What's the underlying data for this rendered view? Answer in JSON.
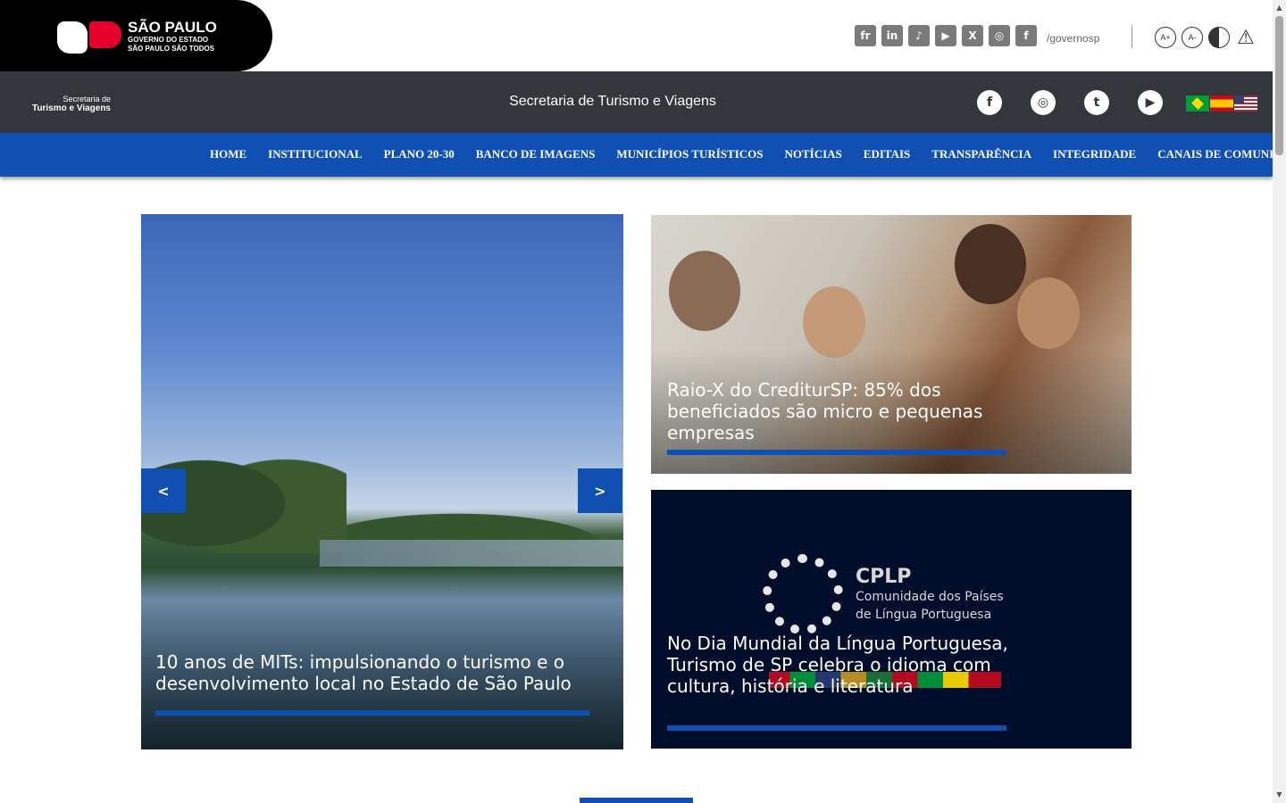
{
  "gov": {
    "title": "SÃO PAULO",
    "subtitle": "GOVERNO DO ESTADO",
    "tagline": "SÃO PAULO SÃO TODOS"
  },
  "top_social": {
    "icons": [
      "flickr-icon",
      "linkedin-icon",
      "tiktok-icon",
      "youtube-icon",
      "x-icon",
      "instagram-icon",
      "facebook-icon"
    ],
    "glyphs": [
      "fr",
      "in",
      "♪",
      "▶",
      "X",
      "◎",
      "f"
    ],
    "handle": "/governosp"
  },
  "accessibility": {
    "increase": "A+",
    "decrease": "A-",
    "warning": "⚠"
  },
  "secretaria": {
    "logo_line1": "Secretaria de",
    "logo_line2": "Turismo e Viagens",
    "title": "Secretaria de Turismo e Viagens",
    "social_glyphs": [
      "f",
      "◎",
      "t",
      "▶"
    ]
  },
  "nav": {
    "items": [
      "HOME",
      "INSTITUCIONAL",
      "PLANO 20-30",
      "BANCO DE IMAGENS",
      "MUNICÍPIOS TURÍSTICOS",
      "NOTÍCIAS",
      "EDITAIS",
      "TRANSPARÊNCIA",
      "INTEGRIDADE",
      "CANAIS DE COMUNICAÇÃO"
    ]
  },
  "slider": {
    "prev": "<",
    "next": ">",
    "main_title": "10 anos de MITs: impulsionando o turismo e o desenvolvimento local no Estado de São Paulo"
  },
  "news": [
    {
      "title": "Raio-X do CrediturSP: 85% dos beneficiados são micro e pequenas empresas"
    },
    {
      "title": "No Dia Mundial da Língua Portuguesa,  Turismo de SP celebra o idioma com cultura, história e literatura"
    }
  ],
  "cplp": {
    "acronym": "CPLP",
    "line1": "Comunidade dos Países",
    "line2": "de Língua Portuguesa"
  },
  "colors": {
    "brand_blue": "#1150b3",
    "dark_bar": "#33363b",
    "navy": "#010e2b"
  }
}
